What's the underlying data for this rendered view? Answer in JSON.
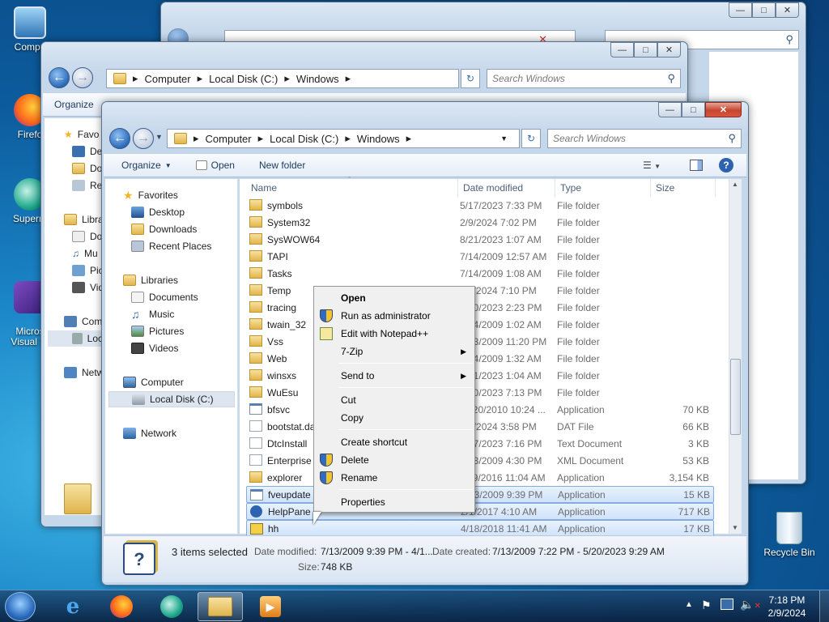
{
  "desktop": {
    "icons": [
      {
        "label": "Compu",
        "icon": "computer-icon"
      },
      {
        "label": "Firefo",
        "icon": "firefox-icon"
      },
      {
        "label": "Superm",
        "icon": "supermium-icon"
      },
      {
        "label": "Micros\nVisual St",
        "icon": "visual-studio-icon"
      },
      {
        "label": "Recycle Bin",
        "icon": "recycle-bin-icon"
      }
    ]
  },
  "back_window": {
    "breadcrumb": [
      "Computer",
      "Local Disk (C:)",
      "Windows"
    ],
    "search_placeholder": "Search Windows",
    "toolbar_organize": "Organize",
    "nav_items": [
      "Favo",
      "Des",
      "Dov",
      "Rec",
      "Libra",
      "Do",
      "Mu",
      "Pic",
      "Vid",
      "Com",
      "Loc",
      "Netw"
    ]
  },
  "main_window": {
    "breadcrumb": [
      "Computer",
      "Local Disk (C:)",
      "Windows"
    ],
    "search_placeholder": "Search Windows",
    "toolbar": {
      "organize": "Organize",
      "open": "Open",
      "new_folder": "New folder"
    },
    "nav": {
      "favorites": "Favorites",
      "desktop": "Desktop",
      "downloads": "Downloads",
      "recent_places": "Recent Places",
      "libraries": "Libraries",
      "documents": "Documents",
      "music": "Music",
      "pictures": "Pictures",
      "videos": "Videos",
      "computer": "Computer",
      "local_disk": "Local Disk (C:)",
      "network": "Network"
    },
    "columns": {
      "name": "Name",
      "date": "Date modified",
      "type": "Type",
      "size": "Size"
    },
    "files": [
      {
        "name": "symbols",
        "date": "5/17/2023 7:33 PM",
        "type": "File folder",
        "size": "",
        "kind": "folder"
      },
      {
        "name": "System32",
        "date": "2/9/2024 7:02 PM",
        "type": "File folder",
        "size": "",
        "kind": "folder"
      },
      {
        "name": "SysWOW64",
        "date": "8/21/2023 1:07 AM",
        "type": "File folder",
        "size": "",
        "kind": "folder"
      },
      {
        "name": "TAPI",
        "date": "7/14/2009 12:57 AM",
        "type": "File folder",
        "size": "",
        "kind": "folder"
      },
      {
        "name": "Tasks",
        "date": "7/14/2009 1:08 AM",
        "type": "File folder",
        "size": "",
        "kind": "folder"
      },
      {
        "name": "Temp",
        "date": "2/9/2024 7:10 PM",
        "type": "File folder",
        "size": "",
        "kind": "folder"
      },
      {
        "name": "tracing",
        "date": "5/20/2023 2:23 PM",
        "type": "File folder",
        "size": "",
        "kind": "folder"
      },
      {
        "name": "twain_32",
        "date": "7/14/2009 1:02 AM",
        "type": "File folder",
        "size": "",
        "kind": "folder"
      },
      {
        "name": "Vss",
        "date": "7/13/2009 11:20 PM",
        "type": "File folder",
        "size": "",
        "kind": "folder"
      },
      {
        "name": "Web",
        "date": "7/14/2009 1:32 AM",
        "type": "File folder",
        "size": "",
        "kind": "folder"
      },
      {
        "name": "winsxs",
        "date": "8/21/2023 1:04 AM",
        "type": "File folder",
        "size": "",
        "kind": "folder"
      },
      {
        "name": "WuEsu",
        "date": "5/20/2023 7:13 PM",
        "type": "File folder",
        "size": "",
        "kind": "folder"
      },
      {
        "name": "bfsvc",
        "date": "11/20/2010 10:24 ...",
        "type": "Application",
        "size": "70 KB",
        "kind": "app"
      },
      {
        "name": "bootstat.dat",
        "date": "2/9/2024 3:58 PM",
        "type": "DAT File",
        "size": "66 KB",
        "kind": "doc"
      },
      {
        "name": "DtcInstall",
        "date": "5/17/2023 7:16 PM",
        "type": "Text Document",
        "size": "3 KB",
        "kind": "doc"
      },
      {
        "name": "Enterprise",
        "date": "7/13/2009 4:30 PM",
        "type": "XML Document",
        "size": "53 KB",
        "kind": "doc"
      },
      {
        "name": "explorer",
        "date": "11/9/2016 11:04 AM",
        "type": "Application",
        "size": "3,154 KB",
        "kind": "explorer"
      },
      {
        "name": "fveupdate",
        "date": "7/13/2009 9:39 PM",
        "type": "Application",
        "size": "15 KB",
        "kind": "app",
        "selected": true
      },
      {
        "name": "HelpPane",
        "date": "2/1/2017 4:10 AM",
        "type": "Application",
        "size": "717 KB",
        "kind": "help",
        "selected": true
      },
      {
        "name": "hh",
        "date": "4/18/2018 11:41 AM",
        "type": "Application",
        "size": "17 KB",
        "kind": "hh",
        "selected": true
      }
    ],
    "status": {
      "selected": "3 items selected",
      "date_modified_label": "Date modified:",
      "date_modified": "7/13/2009 9:39 PM - 4/1...",
      "date_created_label": "Date created:",
      "date_created": "7/13/2009 7:22 PM - 5/20/2023 9:29 AM",
      "size_label": "Size:",
      "size": "748 KB"
    }
  },
  "context_menu": {
    "items": [
      {
        "label": "Open",
        "bold": true
      },
      {
        "label": "Run as administrator",
        "icon": "shield-icon"
      },
      {
        "label": "Edit with Notepad++",
        "icon": "notepad-plus-plus-icon"
      },
      {
        "label": "7-Zip",
        "submenu": true
      },
      {
        "sep": true
      },
      {
        "label": "Send to",
        "submenu": true
      },
      {
        "sep": true
      },
      {
        "label": "Cut"
      },
      {
        "label": "Copy"
      },
      {
        "sep": true
      },
      {
        "label": "Create shortcut"
      },
      {
        "label": "Delete",
        "icon": "shield-icon"
      },
      {
        "label": "Rename",
        "icon": "shield-icon"
      },
      {
        "sep": true
      },
      {
        "label": "Properties"
      }
    ]
  },
  "taskbar": {
    "clock_time": "7:18 PM",
    "clock_date": "2/9/2024",
    "apps": [
      "start-orb-icon",
      "internet-explorer-icon",
      "firefox-icon",
      "supermium-icon",
      "explorer-folder-icon",
      "media-player-icon"
    ]
  }
}
